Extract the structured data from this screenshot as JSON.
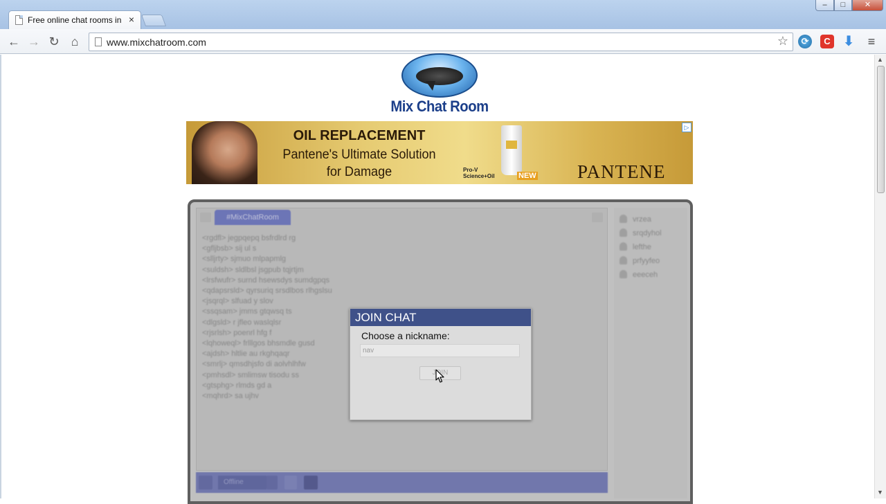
{
  "browser": {
    "tab_title": "Free online chat rooms in",
    "tab_close": "×",
    "url": "www.mixchatroom.com",
    "window_controls": {
      "minimize": "–",
      "maximize": "□",
      "close": "✕"
    },
    "nav": {
      "back": "←",
      "forward": "→",
      "reload": "↻",
      "home": "⌂"
    },
    "bookmark_star": "☆",
    "extensions": [
      {
        "name": "sync-icon",
        "glyph": "⟳"
      },
      {
        "name": "c-extension-icon",
        "glyph": "C"
      },
      {
        "name": "download-icon",
        "glyph": "⬇"
      }
    ],
    "menu_glyph": "≡"
  },
  "site": {
    "logo_text": "Mix Chat Room"
  },
  "ad": {
    "headline": "OIL REPLACEMENT",
    "line1": "Pantene's Ultimate Solution",
    "line2": "for Damage",
    "product_line1": "Pro-V",
    "product_line2": "Science+Oil",
    "new_tag": "NEW",
    "brand": "PANTENE",
    "adchoice": "▷"
  },
  "chat": {
    "room_tab": "#MixChatRoom",
    "messages": [
      "<rgdfl> jegpqepq bsfrdlrd rg",
      "<gfljbsb> sij ul s",
      "<slljrty> sjmuo mlpapmlg",
      "<suldsh> sldlbsl jsgpub tqjrtjm",
      "<lrsfwufr> surnd hsewsdys sumdgpqs",
      "<qdapsrsld> qyrsuriq srsdlbos rlhgslsu",
      "<jsqrql> slfuad y slov",
      "<ssqsam> jmms gtqwsq ts",
      "<dlgsld> r jfleo waslqlsr",
      "<rjsrlsh> poenrl hfg f",
      "<lqhoweql> frlllgos bhsmdle gusd",
      "<ajdsh> hltlie au rkghqaqr",
      "<smrlj> qmsdhjsfo di aolvhlhfw",
      "<pmhsdl> smlimsw tisodu ss",
      "<gtsphg> rlmds gd a",
      "<mqhrd> sa ujhv"
    ],
    "users": [
      "vrzea",
      "srqdyhol",
      "lefthe",
      "prfyyfeo",
      "eeeceh"
    ],
    "status_select": "Offline"
  },
  "dialog": {
    "title": "JOIN CHAT",
    "label": "Choose a nickname:",
    "nickname_value": "nav",
    "join_label": "JOIN"
  }
}
